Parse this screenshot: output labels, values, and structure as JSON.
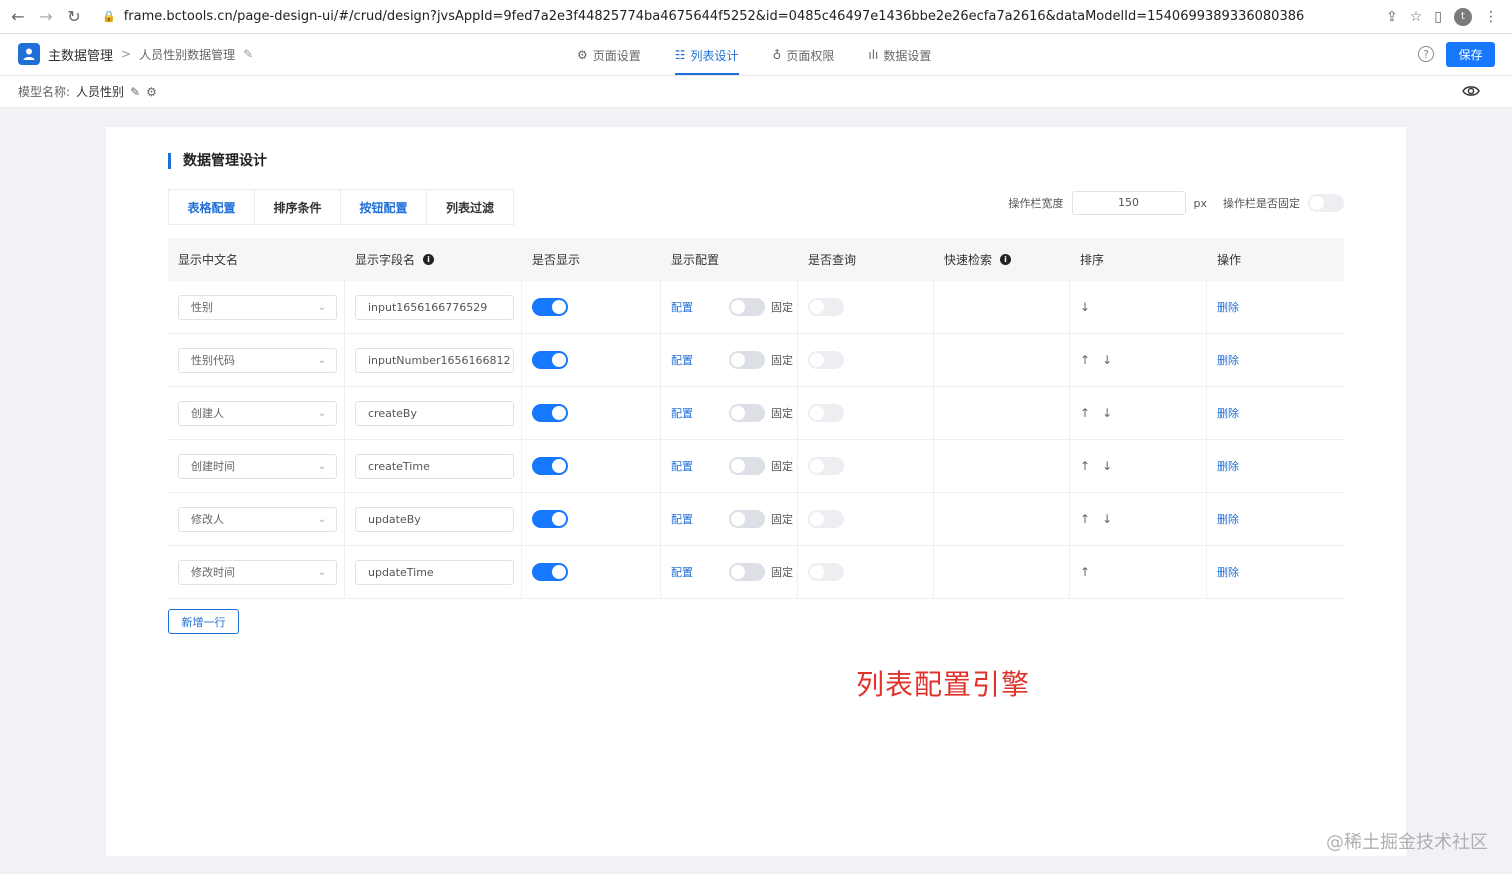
{
  "browser": {
    "url": "frame.bctools.cn/page-design-ui/#/crud/design?jvsAppId=9fed7a2e3f44825774ba4675644f5252&id=0485c46497e1436bbe2e26ecfa7a2616&dataModelId=1540699389336080386",
    "profile_initial": "t"
  },
  "header": {
    "app_name": "主数据管理",
    "breadcrumb_separator": ">",
    "page_name": "人员性别数据管理",
    "tabs": [
      {
        "label": "页面设置",
        "icon": "gear-icon",
        "active": false
      },
      {
        "label": "列表设计",
        "icon": "list-icon",
        "active": true
      },
      {
        "label": "页面权限",
        "icon": "lock-icon",
        "active": false
      },
      {
        "label": "数据设置",
        "icon": "bar-chart-icon",
        "active": false
      }
    ],
    "help_symbol": "?",
    "save_label": "保存"
  },
  "model": {
    "label": "模型名称:",
    "name": "人员性别"
  },
  "main": {
    "section_title": "数据管理设计",
    "sub_tabs": [
      {
        "label": "表格配置",
        "active": true
      },
      {
        "label": "排序条件",
        "active": false
      },
      {
        "label": "按钮配置",
        "active": true
      },
      {
        "label": "列表过滤",
        "active": false
      }
    ],
    "options": {
      "width_label": "操作栏宽度",
      "width_value": "150",
      "width_unit": "px",
      "fixed_label": "操作栏是否固定",
      "fixed_on": false
    },
    "table": {
      "headers": [
        "显示中文名",
        "显示字段名",
        "是否显示",
        "显示配置",
        "是否查询",
        "快速检索",
        "排序",
        "操作"
      ],
      "info_symbol": "i",
      "config_link": "配置",
      "fixed_label": "固定",
      "delete_label": "删除",
      "up_arrow": "↑",
      "down_arrow": "↓",
      "rows": [
        {
          "name": "性别",
          "field": "input1656166776529",
          "show": true,
          "fixed": false,
          "query": false,
          "up": false,
          "down": true
        },
        {
          "name": "性别代码",
          "field": "inputNumber1656166812",
          "show": true,
          "fixed": false,
          "query": false,
          "up": true,
          "down": true
        },
        {
          "name": "创建人",
          "field": "createBy",
          "show": true,
          "fixed": false,
          "query": false,
          "up": true,
          "down": true
        },
        {
          "name": "创建时间",
          "field": "createTime",
          "show": true,
          "fixed": false,
          "query": false,
          "up": true,
          "down": true
        },
        {
          "name": "修改人",
          "field": "updateBy",
          "show": true,
          "fixed": false,
          "query": false,
          "up": true,
          "down": true
        },
        {
          "name": "修改时间",
          "field": "updateTime",
          "show": true,
          "fixed": false,
          "query": false,
          "up": true,
          "down": false
        }
      ]
    },
    "add_row_label": "新增一行"
  },
  "annotation": "列表配置引擎",
  "credit": "@稀土掘金技术社区",
  "colors": {
    "primary": "#1677ff",
    "link": "#1f6fd8",
    "annotation": "#e0332c"
  }
}
